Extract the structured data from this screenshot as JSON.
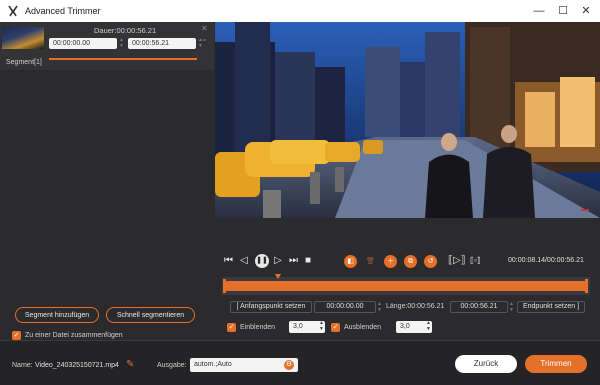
{
  "window": {
    "title": "Advanced Trimmer",
    "minimize": "—",
    "maximize": "☐",
    "close": "✕"
  },
  "segment": {
    "duration": "Dauer:00:00:56.21",
    "start": "00:00:00.00",
    "end": "00:00:56.21",
    "label": "Segment[1]",
    "close_icon": "✕",
    "expand_icon": "⌄"
  },
  "left_actions": {
    "add_segment": "Segment hinzufügen",
    "fast_split": "Schnell segmentieren",
    "merge_label": "Zu einer Datei zusammenfügen",
    "merge_checked": true
  },
  "player": {
    "time_display": "00:00:08.14/00:00:56.21",
    "playhead_fraction": 0.145
  },
  "trim": {
    "set_start": "Anfangspunkt setzen",
    "start_value": "00:00:00.00",
    "length_label": "Länge:00:00:56.21",
    "end_value": "00:00:56.21",
    "set_end": "Endpunkt setzen",
    "fade_in_label": "Einblenden",
    "fade_in_value": "3,0",
    "fade_in_checked": true,
    "fade_out_label": "Ausblenden",
    "fade_out_value": "3,0",
    "fade_out_checked": true
  },
  "footer": {
    "name_label": "Name:",
    "file_name": "Video_240325150721.mp4",
    "output_label": "Ausgabe:",
    "output_value": "autom.;Auto",
    "back_button": "Zurück",
    "trim_button": "Trimmen"
  },
  "colors": {
    "accent": "#e4702a",
    "background": "#2b2b2e"
  }
}
